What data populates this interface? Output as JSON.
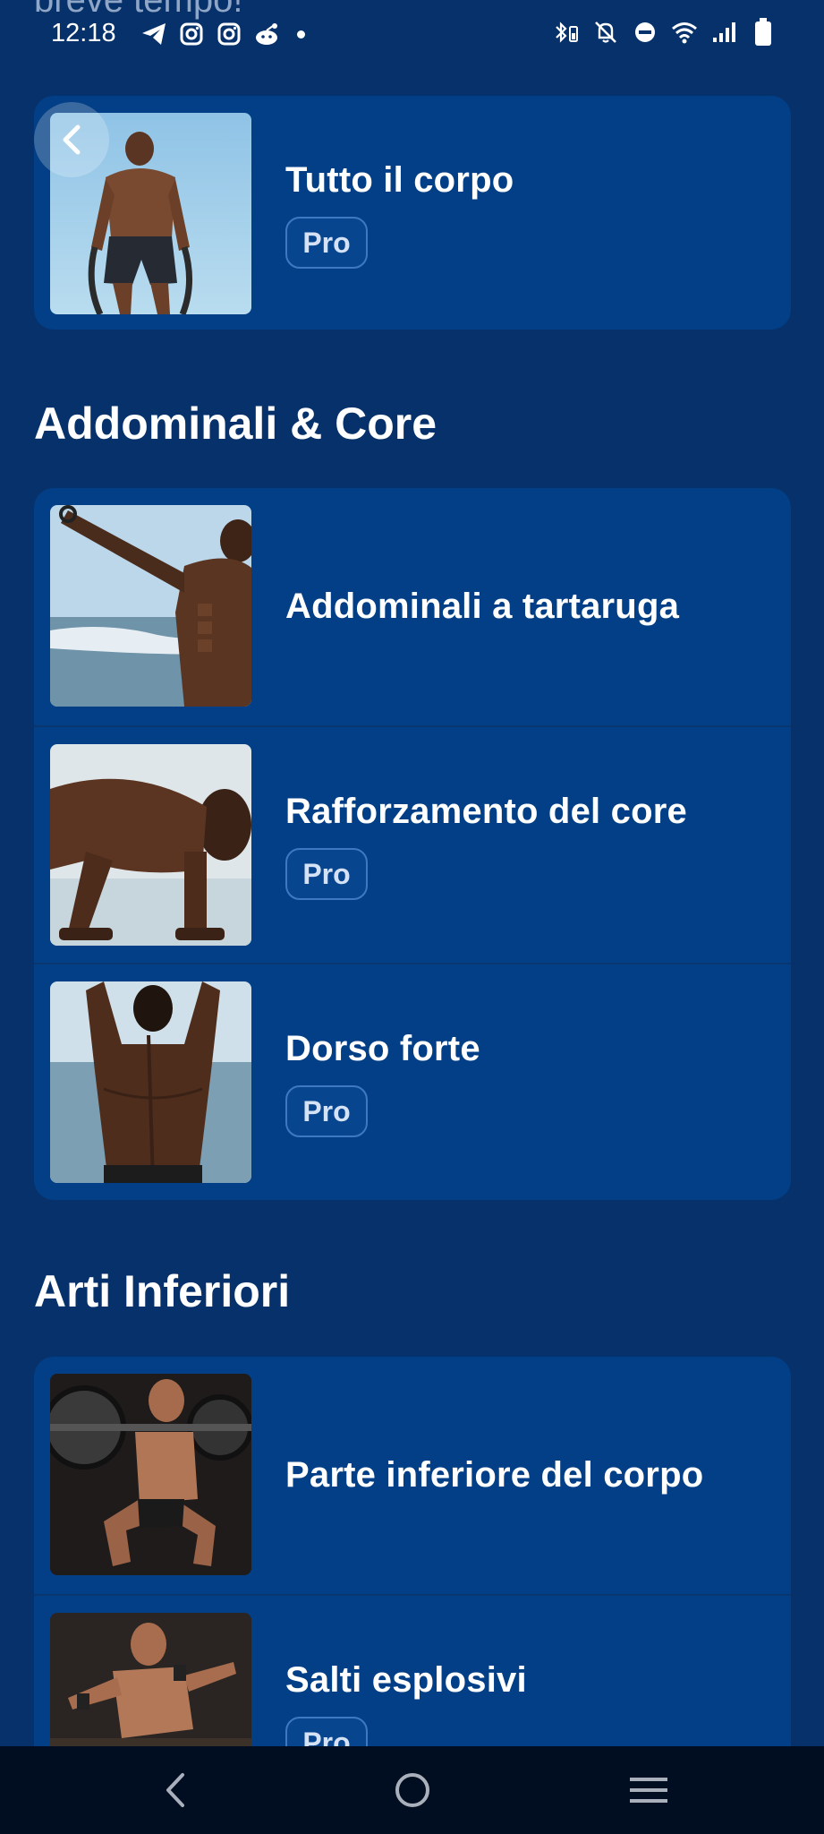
{
  "status_bar": {
    "overlay_text": "breve tempo!",
    "time": "12:18",
    "left_icons": [
      "telegram-icon",
      "instagram-icon",
      "instagram-icon",
      "reddit-icon",
      "notification-dot-icon"
    ],
    "right_icons": [
      "bluetooth-battery-icon",
      "mute-icon",
      "do-not-disturb-icon",
      "wifi-icon",
      "signal-icon",
      "battery-icon"
    ]
  },
  "top_card": {
    "title": "Tutto il corpo",
    "badge": "Pro"
  },
  "sections": [
    {
      "title": "Addominali & Core",
      "items": [
        {
          "title": "Addominali a tartaruga",
          "badge": ""
        },
        {
          "title": "Rafforzamento del core",
          "badge": "Pro"
        },
        {
          "title": "Dorso forte",
          "badge": "Pro"
        }
      ]
    },
    {
      "title": "Arti Inferiori",
      "items": [
        {
          "title": "Parte inferiore del corpo",
          "badge": ""
        },
        {
          "title": "Salti esplosivi",
          "badge": "Pro"
        }
      ]
    }
  ],
  "nav_bar": {
    "icons": [
      "back-icon",
      "home-icon",
      "recents-icon"
    ]
  },
  "colors": {
    "background": "#06316a",
    "card": "#033f86",
    "badge_border": "#3f78c2",
    "nav_bar": "#010d20"
  }
}
